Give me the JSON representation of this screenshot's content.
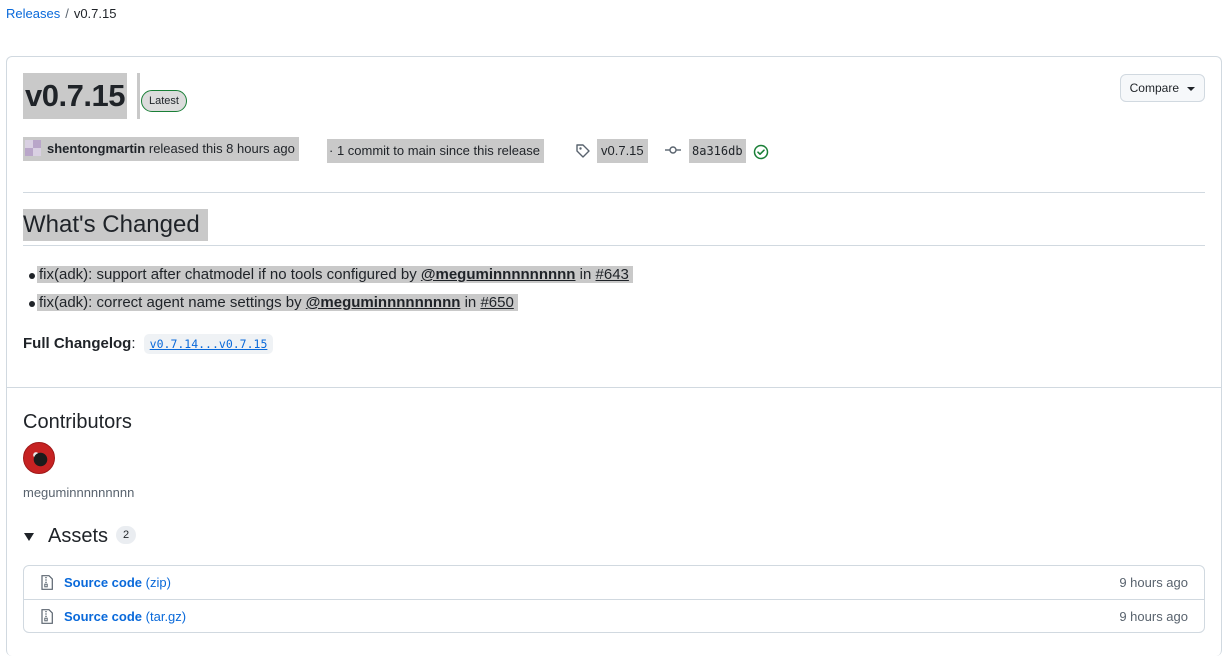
{
  "breadcrumb": {
    "releases_label": "Releases",
    "separator": "/",
    "current": "v0.7.15"
  },
  "release": {
    "title": "v0.7.15",
    "latest_badge": "Latest",
    "compare_label": "Compare",
    "author": "shentongmartin",
    "released_text": "released this 8 hours ago",
    "commits_text": "· 1 commit to main since this release",
    "tag": "v0.7.15",
    "commit_sha": "8a316db"
  },
  "notes": {
    "heading": "What's Changed",
    "items": [
      {
        "text": "fix(adk): support after chatmodel if no tools configured by",
        "user": "@meguminnnnnnnnn",
        "in": "in",
        "pr": "#643"
      },
      {
        "text": "fix(adk): correct agent name settings by",
        "user": "@meguminnnnnnnnn",
        "in": "in",
        "pr": "#650"
      }
    ],
    "full_changelog_label": "Full Changelog",
    "full_changelog_colon": ":",
    "full_changelog_value": "v0.7.14...v0.7.15"
  },
  "contributors": {
    "heading": "Contributors",
    "names": [
      "meguminnnnnnnnn"
    ]
  },
  "assets": {
    "heading": "Assets",
    "count": "2",
    "items": [
      {
        "name": "Source code",
        "ext": "(zip)",
        "time": "9 hours ago"
      },
      {
        "name": "Source code",
        "ext": "(tar.gz)",
        "time": "9 hours ago"
      }
    ]
  },
  "colors": {
    "link": "#0969da",
    "latest_border": "#1a7f37",
    "check": "#1a7f37",
    "highlight": "#c9c9c9"
  },
  "icons": [
    "tag-icon",
    "git-commit-icon",
    "check-circle-icon",
    "file-zip-icon",
    "triangle-down-icon"
  ]
}
